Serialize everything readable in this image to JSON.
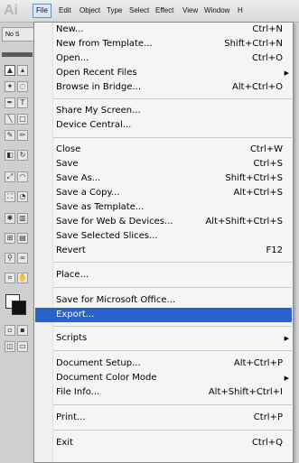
{
  "app": {
    "logo": "Ai"
  },
  "menubar": {
    "items": [
      {
        "label": "File"
      },
      {
        "label": "Edit"
      },
      {
        "label": "Object"
      },
      {
        "label": "Type"
      },
      {
        "label": "Select"
      },
      {
        "label": "Effect"
      },
      {
        "label": "View"
      },
      {
        "label": "Window"
      },
      {
        "label": "H"
      }
    ],
    "active_item": "File"
  },
  "document_tab": {
    "label": "No S"
  },
  "file_menu": {
    "items": [
      {
        "label": "New...",
        "shortcut": "Ctrl+N"
      },
      {
        "label": "New from Template...",
        "shortcut": "Shift+Ctrl+N"
      },
      {
        "label": "Open...",
        "shortcut": "Ctrl+O"
      },
      {
        "label": "Open Recent Files",
        "shortcut": "",
        "submenu": true
      },
      {
        "label": "Browse in Bridge...",
        "shortcut": "Alt+Ctrl+O"
      },
      {
        "label": "Share My Screen...",
        "shortcut": ""
      },
      {
        "label": "Device Central...",
        "shortcut": ""
      },
      {
        "label": "Close",
        "shortcut": "Ctrl+W"
      },
      {
        "label": "Save",
        "shortcut": "Ctrl+S"
      },
      {
        "label": "Save As...",
        "shortcut": "Shift+Ctrl+S"
      },
      {
        "label": "Save a Copy...",
        "shortcut": "Alt+Ctrl+S"
      },
      {
        "label": "Save as Template...",
        "shortcut": ""
      },
      {
        "label": "Save for Web & Devices...",
        "shortcut": "Alt+Shift+Ctrl+S"
      },
      {
        "label": "Save Selected Slices...",
        "shortcut": ""
      },
      {
        "label": "Revert",
        "shortcut": "F12"
      },
      {
        "label": "Place...",
        "shortcut": ""
      },
      {
        "label": "Save for Microsoft Office...",
        "shortcut": ""
      },
      {
        "label": "Export...",
        "shortcut": "",
        "highlighted": true
      },
      {
        "label": "Scripts",
        "shortcut": "",
        "submenu": true
      },
      {
        "label": "Document Setup...",
        "shortcut": "Alt+Ctrl+P"
      },
      {
        "label": "Document Color Mode",
        "shortcut": "",
        "submenu": true
      },
      {
        "label": "File Info...",
        "shortcut": "Alt+Shift+Ctrl+I"
      },
      {
        "label": "Print...",
        "shortcut": "Ctrl+P"
      },
      {
        "label": "Exit",
        "shortcut": "Ctrl+Q"
      }
    ]
  },
  "icons": {
    "submenu": "triangle-right-icon"
  },
  "colors": {
    "highlight": "#2a62c9",
    "menu_bg": "#f5f5f5"
  }
}
